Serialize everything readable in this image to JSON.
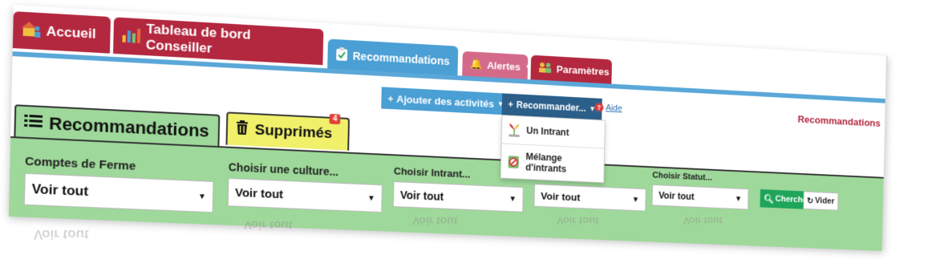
{
  "tabs": {
    "accueil": "Accueil",
    "tableau": "Tableau de bord Conseiller",
    "recommandations": "Recommandations",
    "alertes": "Alertes",
    "parametres": "Paramètres"
  },
  "toolbar": {
    "add_activities": "Ajouter des activités",
    "recommend": "Recommander...",
    "help": "Aide",
    "section_title": "Recommandations"
  },
  "recommend_menu": {
    "items": [
      "Un Intrant",
      "Mélange d'intrants"
    ]
  },
  "subtabs": {
    "recommandations": "Recommandations",
    "supprimes": "Supprimés",
    "supprimes_count": "4"
  },
  "filters": {
    "comptes": {
      "label": "Comptes de Ferme",
      "value": "Voir tout"
    },
    "culture": {
      "label": "Choisir une culture...",
      "value": "Voir tout"
    },
    "intrant": {
      "label": "Choisir Intrant...",
      "value": "Voir tout"
    },
    "fourth": {
      "value": "Voir tout"
    },
    "statut": {
      "label": "Choisir Statut...",
      "value": "Voir tout"
    },
    "search_label": "Chercher",
    "clear_label": "Vider"
  },
  "colors": {
    "tab_red": "#b3283f",
    "tab_blue": "#4a9fd4",
    "tab_pink": "#d46a8a",
    "filter_green": "#9ed89a",
    "deleted_yellow": "#f0f06a",
    "search_green": "#1fa55a"
  },
  "icons": {
    "accueil": "home-users-icon",
    "tableau": "bar-chart-icon",
    "recommandations": "clipboard-check-icon",
    "alertes": "bell-icon",
    "parametres": "people-icon",
    "list": "list-icon",
    "trash": "trash-icon",
    "search": "search-icon",
    "refresh": "refresh-icon"
  }
}
